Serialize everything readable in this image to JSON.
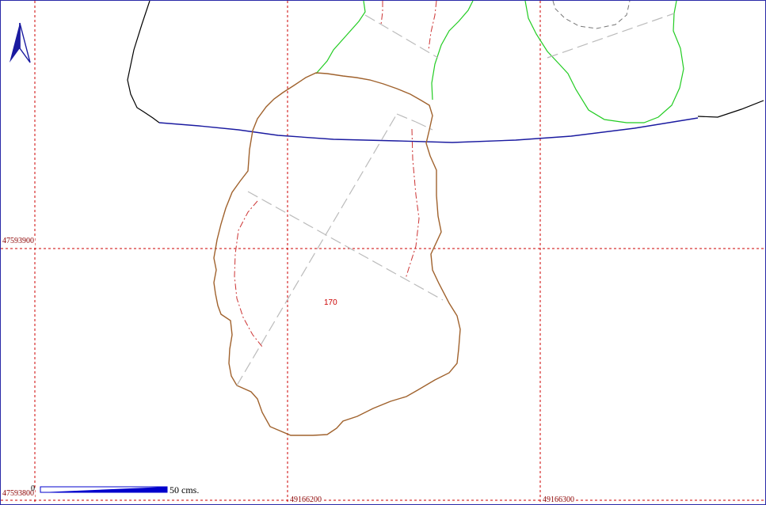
{
  "map": {
    "parcel_label": "170",
    "grid": {
      "y_labels": [
        "47593900",
        "47593800"
      ],
      "x_labels": [
        "49166200",
        "49166300"
      ]
    },
    "scale_bar": {
      "zero_label": "0",
      "length_label": "50  cms."
    },
    "north_arrow_icon": "north-arrow-icon",
    "colors": {
      "background": "#ffffff",
      "grid": "#cc0000",
      "coord_text": "#8b0000",
      "parcel_boundary": "#a0622d",
      "neighbor_boundary": "#22cc22",
      "river": "#1a1aa0",
      "outer_boundary": "#000000",
      "inner_dashed": "#bbbbbb",
      "red_dashdot": "#cc3333",
      "north_arrow": "#1a1aa0",
      "scale_bar": "#0000cc"
    }
  }
}
